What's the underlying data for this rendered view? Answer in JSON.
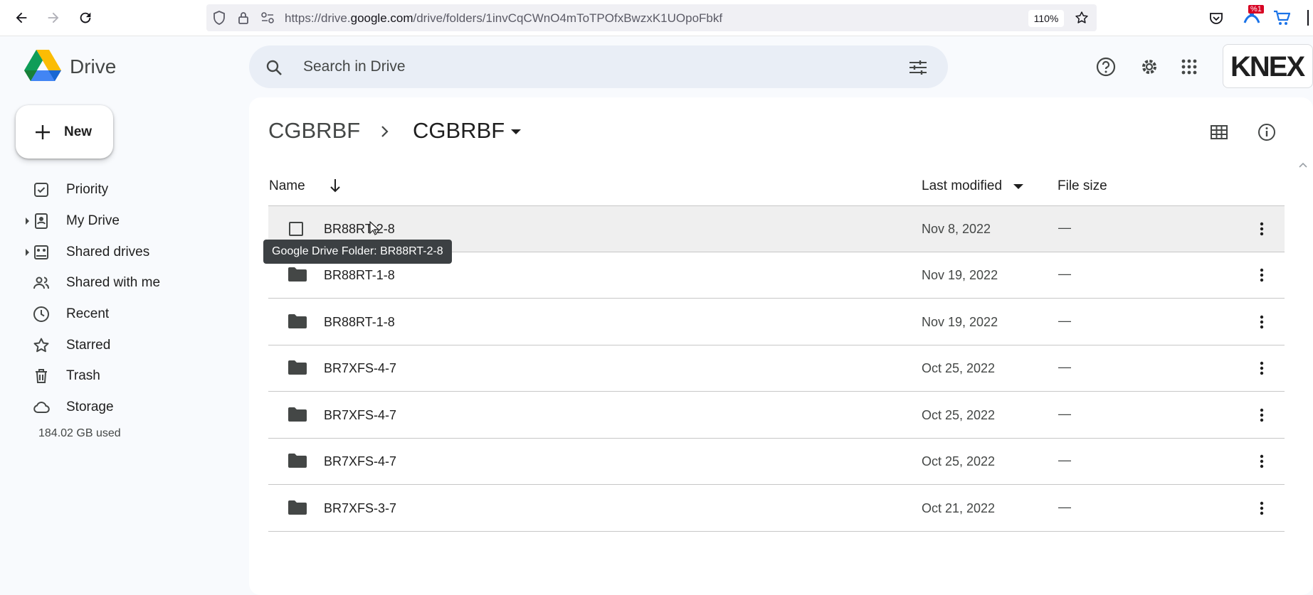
{
  "browser": {
    "url_prefix": "https://drive.",
    "url_domain": "google.com",
    "url_path": "/drive/folders/1invCqCWnO4mToTPOfxBwzxK1UOpoFbkf",
    "zoom": "110%",
    "extension_badge": "%1"
  },
  "app": {
    "name": "Drive",
    "search_placeholder": "Search in Drive",
    "account_logo_text": "KNEX"
  },
  "sidebar": {
    "new_label": "New",
    "items": [
      {
        "label": "Priority",
        "icon": "priority-icon"
      },
      {
        "label": "My Drive",
        "icon": "my-drive-icon"
      },
      {
        "label": "Shared drives",
        "icon": "shared-drives-icon"
      },
      {
        "label": "Shared with me",
        "icon": "shared-with-me-icon"
      },
      {
        "label": "Recent",
        "icon": "recent-icon"
      },
      {
        "label": "Starred",
        "icon": "star-icon"
      },
      {
        "label": "Trash",
        "icon": "trash-icon"
      },
      {
        "label": "Storage",
        "icon": "cloud-icon"
      }
    ],
    "storage_used": "184.02 GB used"
  },
  "breadcrumb": {
    "parent": "CGBRBF",
    "current": "CGBRBF"
  },
  "table": {
    "headers": {
      "name": "Name",
      "modified": "Last modified",
      "size": "File size"
    },
    "rows": [
      {
        "name": "BR88RT-2-8",
        "modified": "Nov 8, 2022",
        "size": "—"
      },
      {
        "name": "BR88RT-1-8",
        "modified": "Nov 19, 2022",
        "size": "—"
      },
      {
        "name": "BR88RT-1-8",
        "modified": "Nov 19, 2022",
        "size": "—"
      },
      {
        "name": "BR7XFS-4-7",
        "modified": "Oct 25, 2022",
        "size": "—"
      },
      {
        "name": "BR7XFS-4-7",
        "modified": "Oct 25, 2022",
        "size": "—"
      },
      {
        "name": "BR7XFS-4-7",
        "modified": "Oct 25, 2022",
        "size": "—"
      },
      {
        "name": "BR7XFS-3-7",
        "modified": "Oct 21, 2022",
        "size": "—"
      }
    ]
  },
  "tooltip": "Google Drive Folder: BR88RT-2-8",
  "colors": {
    "accent_bg": "#e9eef6",
    "hover_row": "#efefef",
    "tooltip_bg": "#3c4043",
    "folder_icon": "#444746"
  }
}
